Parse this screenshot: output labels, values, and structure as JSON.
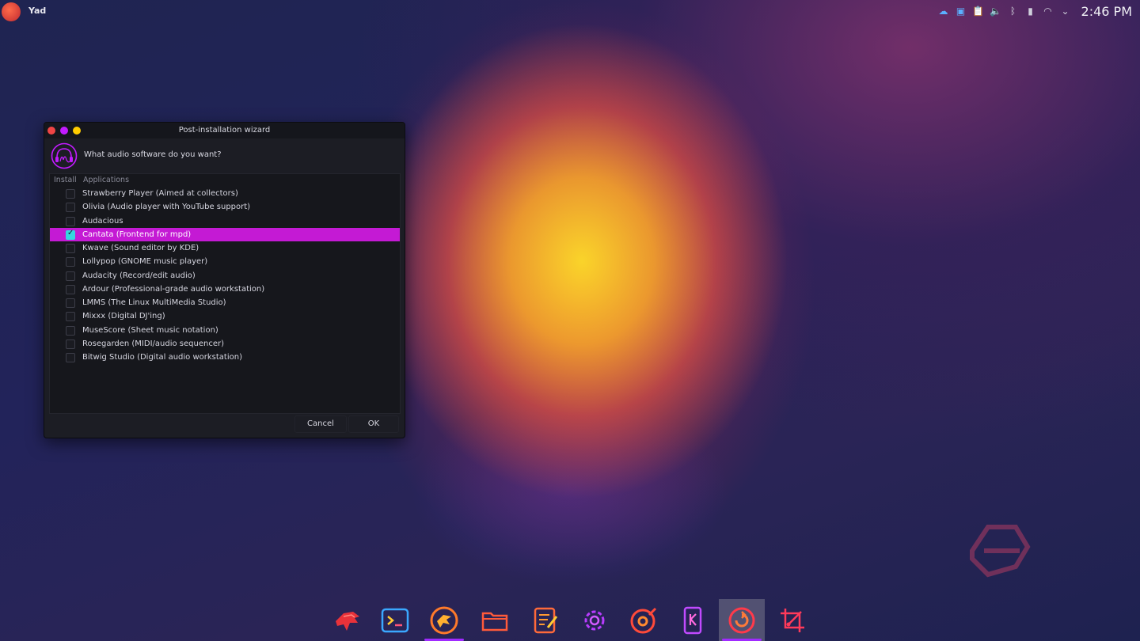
{
  "topbar": {
    "app_name": "Yad",
    "clock": "2:46 PM",
    "tray_icons": [
      "cloud-icon",
      "screenshot-icon",
      "clipboard-icon",
      "volume-icon",
      "bluetooth-icon",
      "battery-icon",
      "wifi-icon",
      "chevron-down-icon"
    ]
  },
  "dialog": {
    "title": "Post-installation wizard",
    "question": "What audio software do you want?",
    "columns": {
      "install": "Install",
      "applications": "Applications"
    },
    "items": [
      {
        "label": "Strawberry Player (Aimed at collectors)",
        "checked": false
      },
      {
        "label": "Olivia (Audio player with YouTube support)",
        "checked": false
      },
      {
        "label": "Audacious",
        "checked": false
      },
      {
        "label": "Cantata (Frontend for mpd)",
        "checked": true
      },
      {
        "label": "Kwave (Sound editor by KDE)",
        "checked": false
      },
      {
        "label": "Lollypop (GNOME music player)",
        "checked": false
      },
      {
        "label": "Audacity (Record/edit audio)",
        "checked": false
      },
      {
        "label": "Ardour (Professional-grade audio workstation)",
        "checked": false
      },
      {
        "label": "LMMS (The Linux MultiMedia Studio)",
        "checked": false
      },
      {
        "label": "Mixxx (Digital DJ'ing)",
        "checked": false
      },
      {
        "label": "MuseScore (Sheet music notation)",
        "checked": false
      },
      {
        "label": "Rosegarden (MIDI/audio sequencer)",
        "checked": false
      },
      {
        "label": "Bitwig Studio (Digital audio workstation)",
        "checked": false
      }
    ],
    "cancel_label": "Cancel",
    "ok_label": "OK"
  },
  "dock": {
    "items": [
      "garuda-eagle-icon",
      "terminal-icon",
      "garuda-browser-icon",
      "files-icon",
      "text-editor-icon",
      "settings-icon",
      "music-player-icon",
      "kdeconnect-icon",
      "garuda-update-icon",
      "screenshot-crop-icon"
    ],
    "active_index": 8
  },
  "colors": {
    "accent": "#c41ad4",
    "check": "#34d7e0",
    "indicator": "#a02bff"
  }
}
